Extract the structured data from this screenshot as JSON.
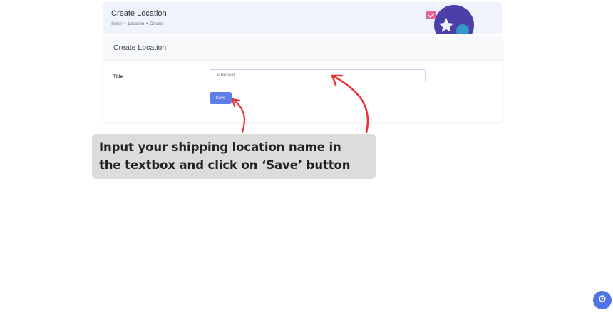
{
  "header": {
    "title": "Create Location",
    "breadcrumb": [
      "Seller",
      "Location",
      "Create"
    ]
  },
  "form": {
    "card_title": "Create Location",
    "title_label": "Title",
    "title_placeholder": "i.e Butwal",
    "title_value": "",
    "save_label": "Save"
  },
  "annotation": {
    "text": "Input your shipping location name in\nthe textbox and click on ‘Save’ button",
    "arrow_color": "#e8323c"
  },
  "colors": {
    "accent": "#5f7de6",
    "banner_bg": "#eef3fc",
    "fab": "#4e74e6"
  },
  "icons": {
    "fab": "settings-icon"
  }
}
